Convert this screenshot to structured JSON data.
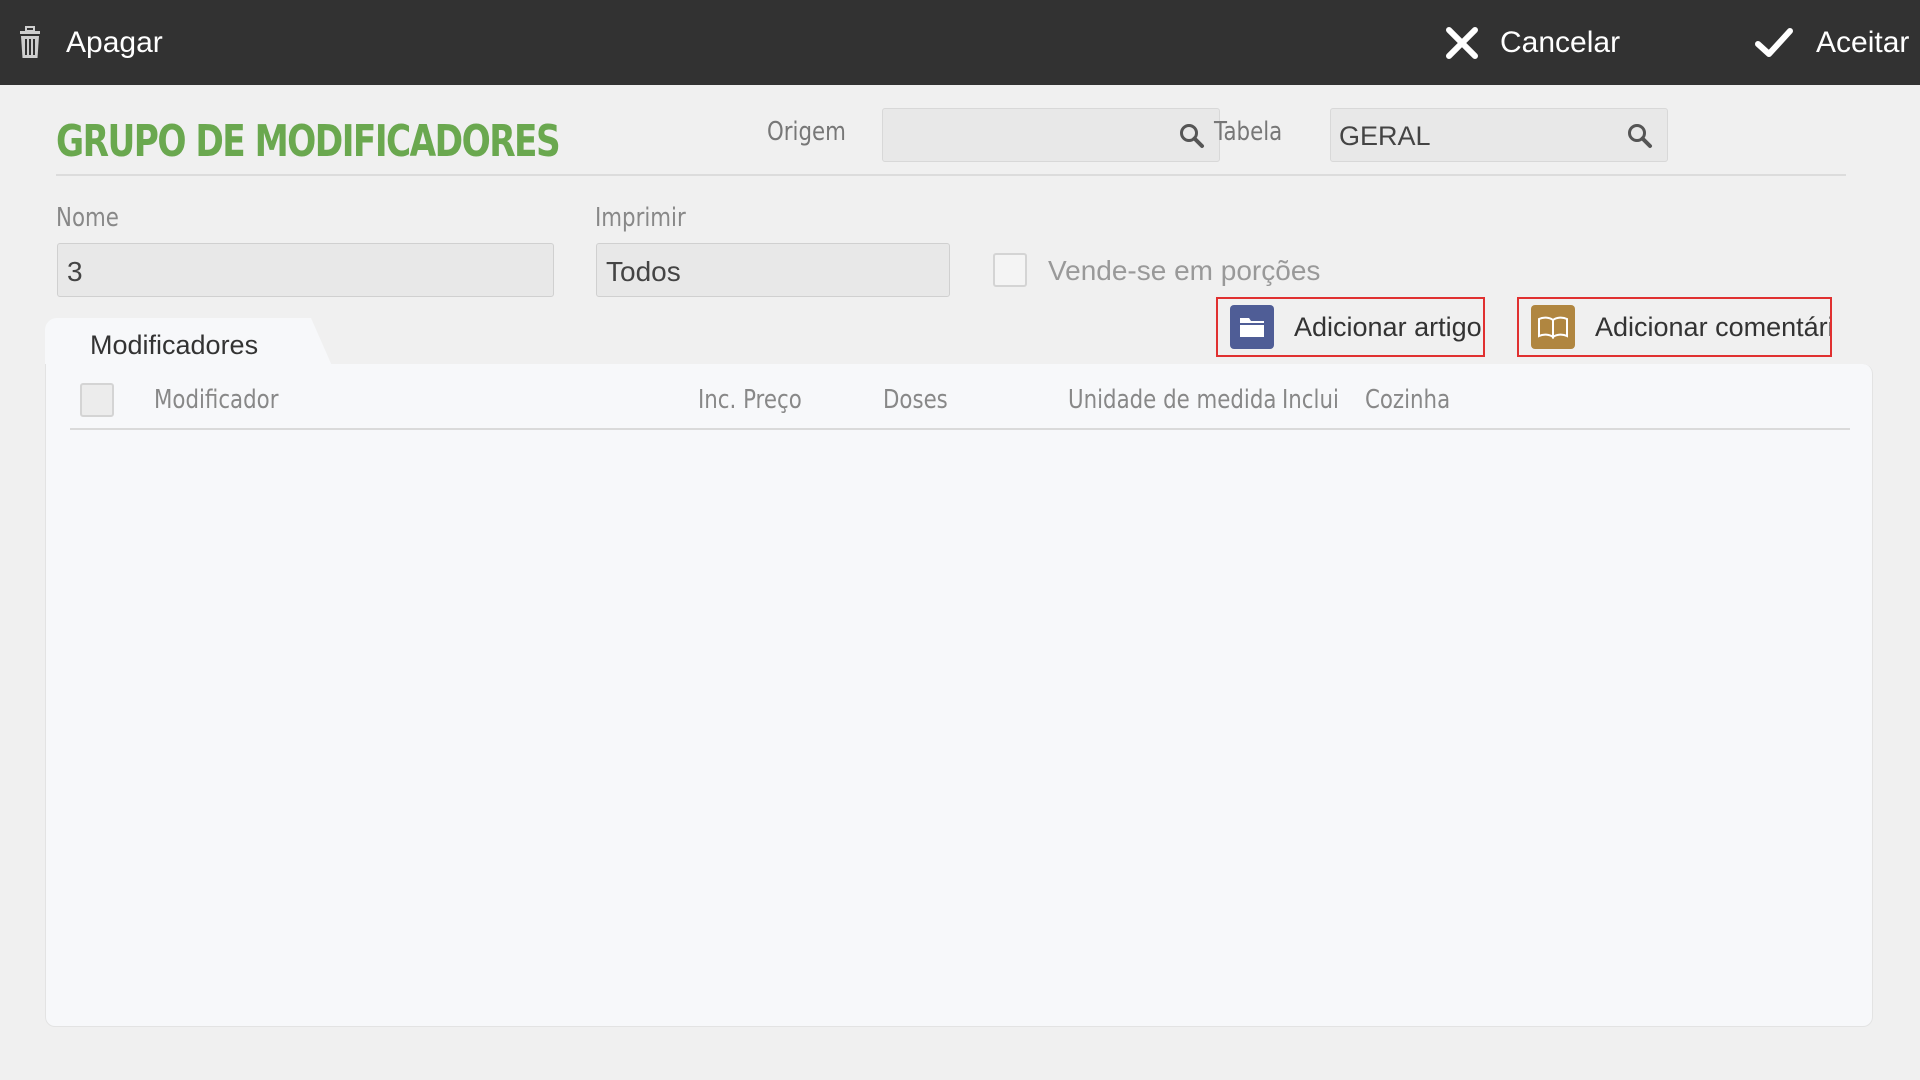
{
  "toolbar": {
    "delete_label": "Apagar",
    "cancel_label": "Cancelar",
    "accept_label": "Aceitar"
  },
  "header": {
    "title": "GRUPO DE MODIFICADORES",
    "origem_label": "Origem",
    "origem_value": "",
    "tabela_label": "Tabela",
    "tabela_value": "GERAL"
  },
  "form": {
    "nome_label": "Nome",
    "nome_value": "3",
    "imprimir_label": "Imprimir",
    "imprimir_value": "Todos",
    "porcoes_label": "Vende-se em porções",
    "porcoes_checked": false
  },
  "actions": {
    "add_article_label": "Adicionar artigo",
    "add_comment_label": "Adicionar comentári"
  },
  "tabs": [
    {
      "label": "Modificadores",
      "active": true
    }
  ],
  "table": {
    "columns": [
      "Modificador",
      "Inc. Preço",
      "Doses",
      "Unidade de medida",
      "Inclui",
      "Cozinha"
    ],
    "rows": []
  },
  "colors": {
    "title_green": "#6aa84f",
    "topbar": "#323232",
    "article_icon_bg": "#4f5d96",
    "comment_icon_bg": "#b08640",
    "highlight_border": "#e03030"
  },
  "icons": {
    "delete": "trash-icon",
    "cancel": "close-icon",
    "accept": "checkmark-icon",
    "search": "search-icon",
    "article": "folder-icon",
    "comment": "book-icon"
  }
}
